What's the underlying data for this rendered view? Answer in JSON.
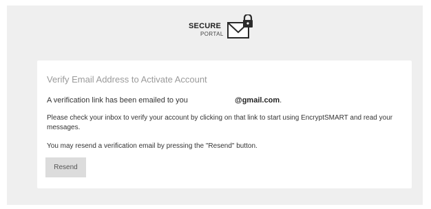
{
  "logo": {
    "line1": "SECURE",
    "line2": "PORTAL",
    "icon": "envelope-lock-icon"
  },
  "card": {
    "title": "Verify Email Address to Activate Account",
    "sent_text": "A verification link has been emailed to you",
    "email_domain": "@gmail.com",
    "sent_suffix": ".",
    "instructions": "Please check your inbox to verify your account by clicking on that link to start using EncryptSMART and read your messages.",
    "resend_hint": "You may resend a verification email by pressing the \"Resend\" button.",
    "resend_label": "Resend"
  },
  "colors": {
    "page_background": "#efefef",
    "card_background": "#ffffff",
    "button_background": "#dcdcdc",
    "title_text": "#9a9a9a"
  }
}
